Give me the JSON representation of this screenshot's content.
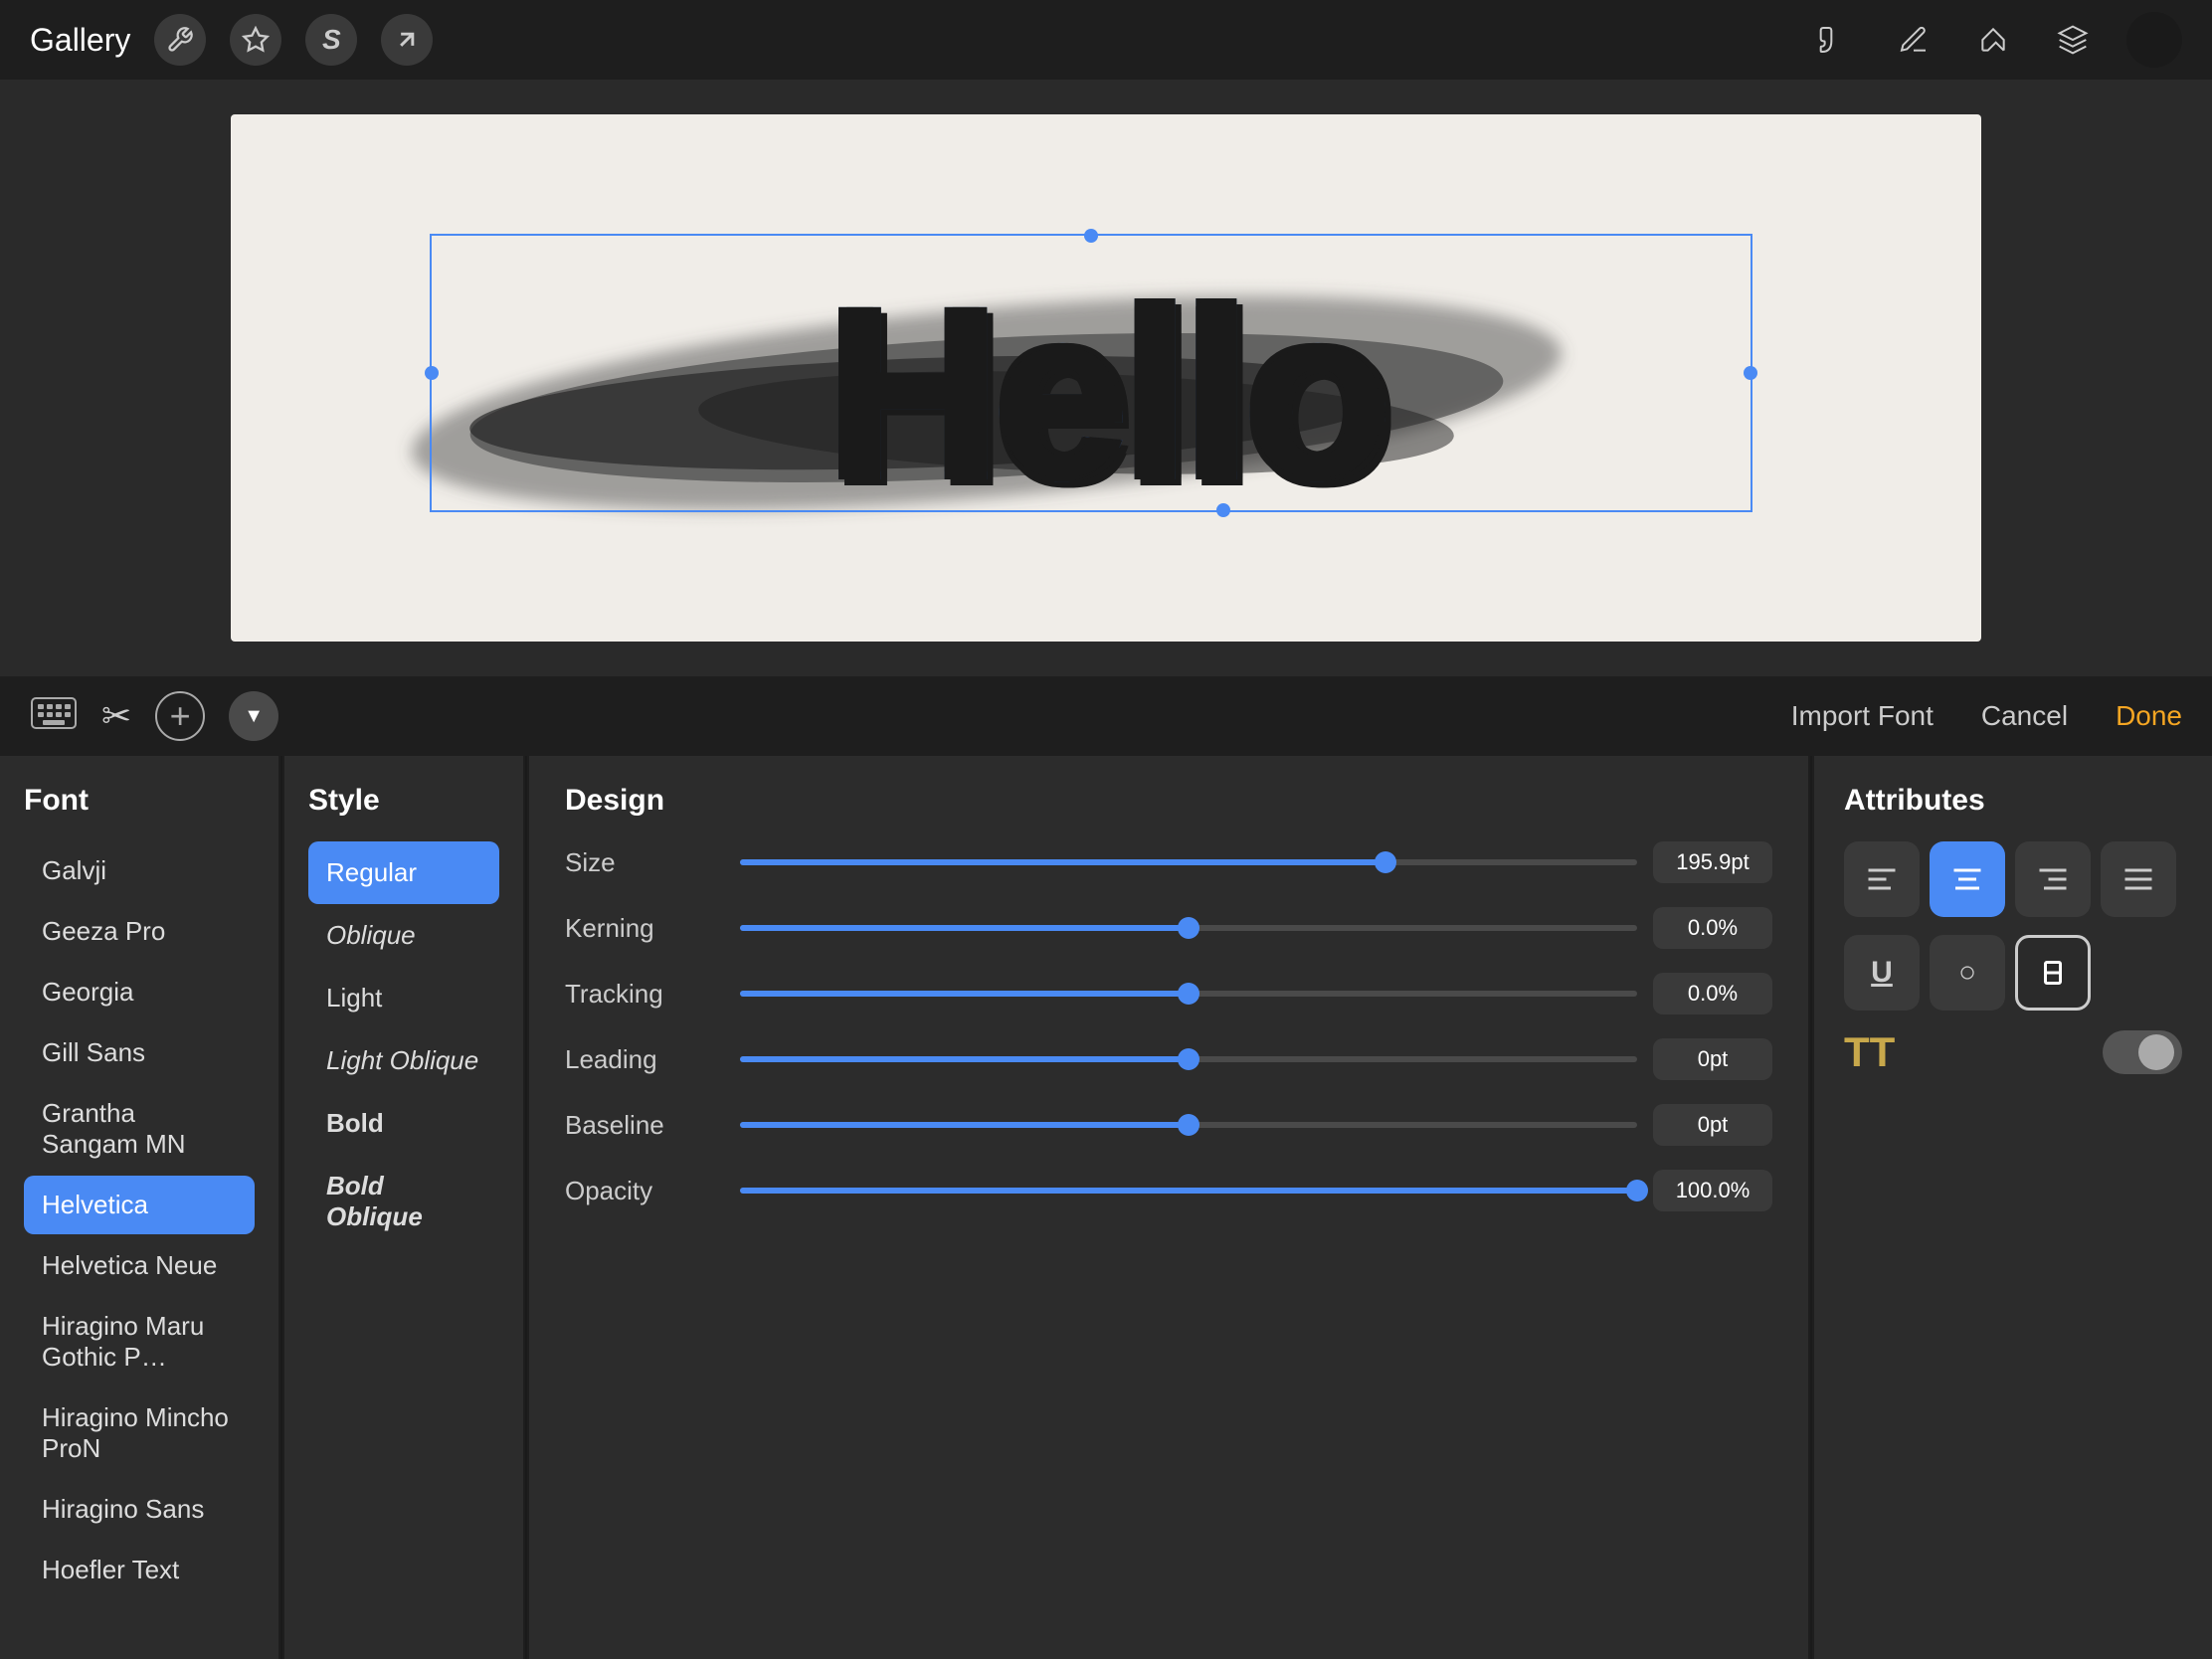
{
  "app": {
    "gallery_label": "Gallery"
  },
  "top_icons": [
    {
      "name": "wrench-icon",
      "symbol": "🔧"
    },
    {
      "name": "magic-icon",
      "symbol": "✦"
    },
    {
      "name": "script-icon",
      "symbol": "S"
    },
    {
      "name": "arrow-icon",
      "symbol": "↗"
    }
  ],
  "top_right_icons": [
    {
      "name": "brush-icon",
      "symbol": "✏"
    },
    {
      "name": "smudge-icon",
      "symbol": "⌇"
    },
    {
      "name": "eraser-icon",
      "symbol": "◻"
    },
    {
      "name": "layers-icon",
      "symbol": "⧉"
    },
    {
      "name": "color-icon",
      "symbol": "●"
    }
  ],
  "canvas": {
    "hello_text": "Hello"
  },
  "toolbar": {
    "keyboard_icon": "⌨",
    "scissors_icon": "✂",
    "add_icon": "+",
    "dropdown_icon": "▼",
    "import_font_label": "Import Font",
    "cancel_label": "Cancel",
    "done_label": "Done"
  },
  "font_panel": {
    "title": "Font",
    "items": [
      {
        "label": "Galvji",
        "selected": false
      },
      {
        "label": "Geeza Pro",
        "selected": false
      },
      {
        "label": "Georgia",
        "selected": false
      },
      {
        "label": "Gill Sans",
        "selected": false
      },
      {
        "label": "Grantha Sangam MN",
        "selected": false
      },
      {
        "label": "Helvetica",
        "selected": true
      },
      {
        "label": "Helvetica Neue",
        "selected": false
      },
      {
        "label": "Hiragino Maru Gothic P…",
        "selected": false
      },
      {
        "label": "Hiragino Mincho ProN",
        "selected": false
      },
      {
        "label": "Hiragino Sans",
        "selected": false
      },
      {
        "label": "Hoefler Text",
        "selected": false
      }
    ]
  },
  "style_panel": {
    "title": "Style",
    "items": [
      {
        "label": "Regular",
        "selected": true,
        "style": "regular"
      },
      {
        "label": "Oblique",
        "selected": false,
        "style": "oblique"
      },
      {
        "label": "Light",
        "selected": false,
        "style": "light"
      },
      {
        "label": "Light Oblique",
        "selected": false,
        "style": "light-oblique"
      },
      {
        "label": "Bold",
        "selected": false,
        "style": "bold"
      },
      {
        "label": "Bold Oblique",
        "selected": false,
        "style": "bold-oblique"
      }
    ]
  },
  "design_panel": {
    "title": "Design",
    "rows": [
      {
        "label": "Size",
        "value": "195.9pt",
        "fill_pct": 72
      },
      {
        "label": "Kerning",
        "value": "0.0%",
        "fill_pct": 50
      },
      {
        "label": "Tracking",
        "value": "0.0%",
        "fill_pct": 50
      },
      {
        "label": "Leading",
        "value": "0pt",
        "fill_pct": 50
      },
      {
        "label": "Baseline",
        "value": "0pt",
        "fill_pct": 50
      },
      {
        "label": "Opacity",
        "value": "100.0%",
        "fill_pct": 100
      }
    ]
  },
  "attributes_panel": {
    "title": "Attributes",
    "alignment": [
      {
        "name": "align-left",
        "selected": false
      },
      {
        "name": "align-center",
        "selected": true
      },
      {
        "name": "align-right",
        "selected": false
      },
      {
        "name": "align-justify",
        "selected": false
      }
    ],
    "style_buttons": [
      {
        "name": "underline",
        "label": "U",
        "selected": false
      },
      {
        "name": "outline",
        "label": "○",
        "selected": false
      },
      {
        "name": "strikethrough",
        "label": "!",
        "selected": true
      }
    ],
    "tt_label": "TT",
    "toggle_active": false
  }
}
